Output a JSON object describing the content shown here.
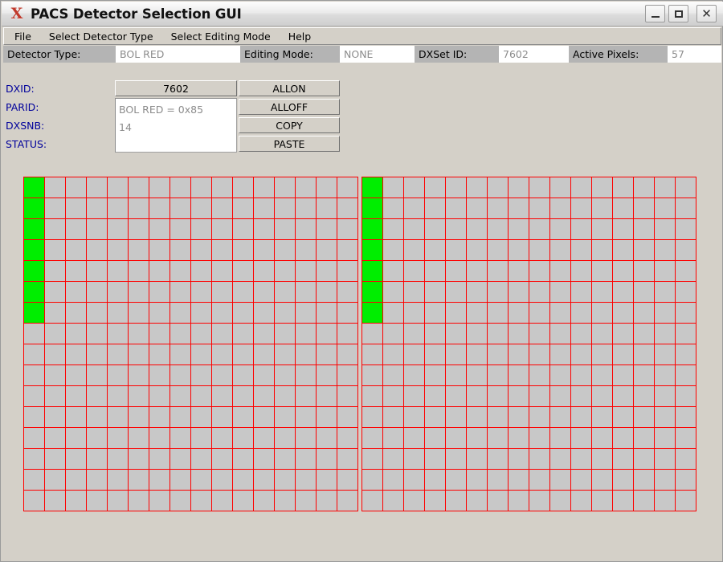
{
  "window": {
    "title": "PACS Detector Selection GUI",
    "logo_icon": "x-logo-icon",
    "minimize_label": "",
    "maximize_label": "",
    "close_label": "✕"
  },
  "menubar": {
    "items": [
      {
        "label": "File"
      },
      {
        "label": "Select Detector Type"
      },
      {
        "label": "Select Editing Mode"
      },
      {
        "label": "Help"
      }
    ]
  },
  "header_strip": {
    "fields": [
      {
        "label": "Detector Type:",
        "value": "BOL RED",
        "label_width": 140,
        "value_width": 155
      },
      {
        "label": "Editing Mode:",
        "value": "NONE",
        "label_width": 124,
        "value_width": 93
      },
      {
        "label": "DXSet ID:",
        "value": "7602",
        "label_width": 105,
        "value_width": 87
      },
      {
        "label": "Active Pixels:",
        "value": "57",
        "label_width": 123,
        "value_width": 67
      }
    ]
  },
  "info_panel": {
    "labels": [
      {
        "label": "DXID:"
      },
      {
        "label": "PARID:"
      },
      {
        "label": "DXSNB:"
      },
      {
        "label": "STATUS:"
      }
    ],
    "dxid_value": "7602",
    "text_lines": [
      "BOL RED = 0x85",
      "14"
    ],
    "buttons": [
      {
        "label": "ALLON"
      },
      {
        "label": "ALLOFF"
      },
      {
        "label": "COPY"
      },
      {
        "label": "PASTE"
      }
    ]
  },
  "detector_grids": {
    "columns": 16,
    "rows": 16,
    "grid_line_color": "#fe0000",
    "cell_off_color": "#c8c8c8",
    "cell_on_color": "#00ee00",
    "panels": [
      {
        "name": "left-detector-grid",
        "active_cells": [
          [
            0,
            0
          ],
          [
            1,
            0
          ],
          [
            2,
            0
          ],
          [
            3,
            0
          ],
          [
            4,
            0
          ],
          [
            5,
            0
          ],
          [
            6,
            0
          ]
        ]
      },
      {
        "name": "right-detector-grid",
        "active_cells": [
          [
            0,
            0
          ],
          [
            1,
            0
          ],
          [
            2,
            0
          ],
          [
            3,
            0
          ],
          [
            4,
            0
          ],
          [
            5,
            0
          ],
          [
            6,
            0
          ]
        ]
      }
    ]
  }
}
